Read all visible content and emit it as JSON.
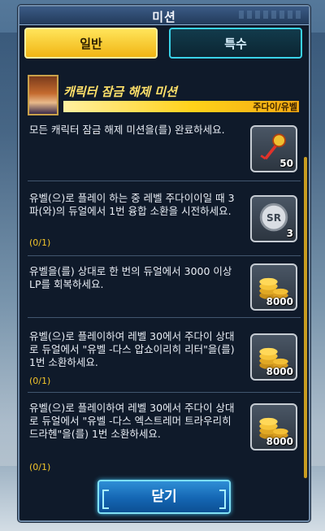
{
  "window": {
    "title": "미션"
  },
  "tabs": [
    {
      "label": "일반",
      "active": true
    },
    {
      "label": "특수",
      "active": false
    }
  ],
  "character": {
    "name": "캐릭터 잠금 해제 미션",
    "tag": "주다이/유벨"
  },
  "missions": [
    {
      "desc": "모든 캐릭터 잠금 해제 미션을(를) 완료하세요.",
      "progress": "",
      "reward_icon": "key-icon",
      "reward_qty": "50"
    },
    {
      "desc": "유벨(으)로 플레이 하는 중 레벨 주다이이일 때 3파(와)의 듀얼에서 1번 융합 소환을 시전하세요.",
      "progress": "(0/1)",
      "reward_icon": "sr-ticket-icon",
      "reward_qty": "3"
    },
    {
      "desc": "유벨을(를) 상대로 한 번의 듀얼에서 3000 이상 LP를 회복하세요.",
      "progress": "(0/1)",
      "reward_icon": "gold-coins-icon",
      "reward_qty": "8000"
    },
    {
      "desc": "유벨(으)로 플레이하여 레벨 30에서 주다이 상대로 듀얼에서 \"유벨 -다스 압쇼이리히 리터\"을(를) 1번 소환하세요.",
      "progress": "(0/1)",
      "reward_icon": "gold-coins-icon",
      "reward_qty": "8000"
    },
    {
      "desc": "유벨(으)로 플레이하여 레벨 30에서 주다이 상대로 듀얼에서 \"유벨 -다스 엑스트레머 트라우리히 드라헨\"을(를) 1번 소환하세요.",
      "progress": "(0/1)",
      "reward_icon": "gold-coins-icon",
      "reward_qty": "8000"
    }
  ],
  "footer": {
    "close_label": "닫기"
  },
  "colors": {
    "accent_yellow": "#f1b514",
    "panel_bg": "#0f1a2a",
    "button_blue": "#1466b3"
  }
}
